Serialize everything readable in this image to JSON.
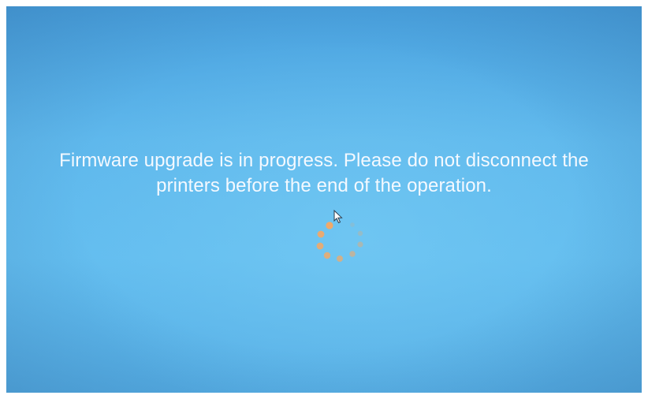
{
  "status": {
    "message_line1": "Firmware upgrade is in progress. Please do not disconnect the",
    "message_line2": "printers before the end of the operation."
  },
  "spinner": {
    "icon": "loading-spinner-icon",
    "dot_color": "#f0a96a",
    "dot_count": 10
  },
  "colors": {
    "background": "#5fb8ec",
    "text": "#f4f9ff"
  }
}
